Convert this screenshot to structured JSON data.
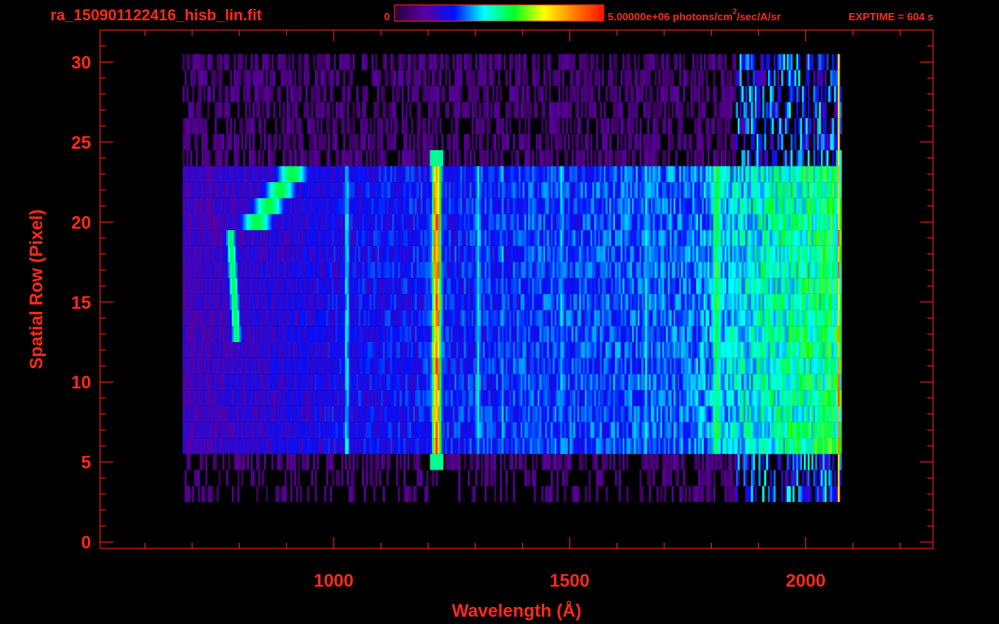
{
  "header": {
    "filename": "ra_150901122416_hisb_lin.fit",
    "colorbar_min": "0",
    "colorbar_max_label": "5.00000e+06 photons/cm",
    "colorbar_units_sup": "2",
    "colorbar_units_rest": "/sec/A/sr",
    "exptime": "EXPTIME = 604 s"
  },
  "colors": {
    "axis": "#ff2a1a",
    "background": "#000000",
    "colormap": [
      "#2a0038",
      "#5a00a0",
      "#0010ff",
      "#00ffff",
      "#00ff20",
      "#ffff00",
      "#ff8000",
      "#ff1000"
    ]
  },
  "chart_data": {
    "type": "heatmap",
    "title": "ra_150901122416_hisb_lin.fit",
    "xlabel": "Wavelength (Å)",
    "ylabel": "Spatial Row (Pixel)",
    "xlim": [
      505,
      2270
    ],
    "ylim": [
      -0.4,
      32
    ],
    "xticks": [
      "1000",
      "1500",
      "2000"
    ],
    "xtick_values": [
      1000,
      1500,
      2000
    ],
    "yticks": [
      "0",
      "5",
      "10",
      "15",
      "20",
      "25",
      "30"
    ],
    "ytick_values": [
      0,
      5,
      10,
      15,
      20,
      25,
      30
    ],
    "value_range": [
      0,
      5000000
    ],
    "units": "photons/cm^2/sec/A/sr",
    "signal_rows": [
      6,
      23
    ],
    "faint_rows": [
      3,
      30
    ],
    "wavelength_range": [
      680,
      2075
    ],
    "continuum": [
      {
        "wavelength": 700,
        "level": 0.18
      },
      {
        "wavelength": 1000,
        "level": 0.25
      },
      {
        "wavelength": 1400,
        "level": 0.3
      },
      {
        "wavelength": 1750,
        "level": 0.33
      },
      {
        "wavelength": 1900,
        "level": 0.45
      },
      {
        "wavelength": 2050,
        "level": 0.52
      }
    ],
    "lines": [
      {
        "wavelength": 1026,
        "level": 0.42,
        "width": 8
      },
      {
        "wavelength": 1216,
        "level": 0.88,
        "width": 12
      },
      {
        "wavelength": 1304,
        "level": 0.45,
        "width": 8
      },
      {
        "wavelength": 1356,
        "level": 0.36,
        "width": 6
      },
      {
        "wavelength": 1480,
        "level": 0.4,
        "width": 8
      },
      {
        "wavelength": 1660,
        "level": 0.42,
        "width": 8
      },
      {
        "wavelength": 1810,
        "level": 0.55,
        "width": 14
      },
      {
        "wavelength": 2068,
        "level": 0.8,
        "width": 3
      }
    ],
    "arc_feature": {
      "rows": [
        13,
        23
      ],
      "wavelength": [
        770,
        900
      ],
      "level": 0.55
    }
  }
}
